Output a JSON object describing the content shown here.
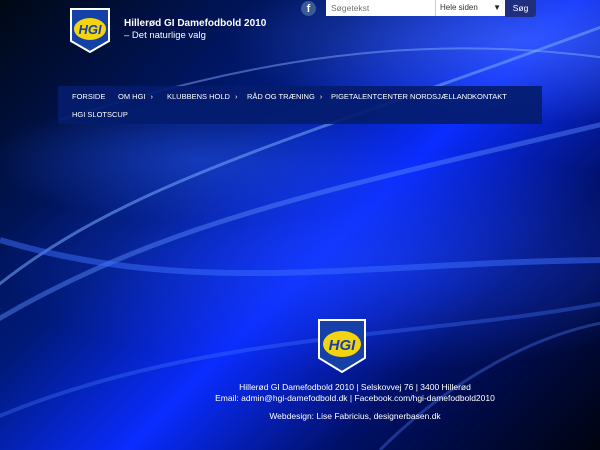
{
  "header": {
    "logo_text": "HGI",
    "title": "Hillerød GI Damefodbold 2010",
    "tagline": "– Det naturlige valg"
  },
  "social": {
    "facebook_glyph": "f"
  },
  "search": {
    "placeholder": "Søgetekst",
    "scope": "Hele siden",
    "button_label": "Søg"
  },
  "nav": {
    "items": [
      {
        "label": "FORSIDE",
        "has_submenu": false
      },
      {
        "label": "OM HGI",
        "has_submenu": true
      },
      {
        "label": "KLUBBENS HOLD",
        "has_submenu": true
      },
      {
        "label": "RÅD OG TRÆNING",
        "has_submenu": true
      },
      {
        "label": "PIGETALENTCENTER NORDSJÆLLAND",
        "has_submenu": false
      },
      {
        "label": "KONTAKT",
        "has_submenu": false
      },
      {
        "label": "HGI SLOTSCUP",
        "has_submenu": false
      }
    ],
    "chevron": "›"
  },
  "footer": {
    "address_line": "Hillerød GI Damefodbold 2010   |   Selskovvej 76   |   3400 Hillerød",
    "contact_line": "Email: admin@hgi-damefodbold.dk   |   Facebook.com/hgi-damefodbold2010",
    "credit_line": "Webdesign: Lise Fabricius, designerbasen.dk"
  },
  "colors": {
    "nav_bg": "#041c6e",
    "logo_blue": "#1540a8",
    "logo_yellow": "#f2d410",
    "search_button": "#1f2f7e"
  }
}
